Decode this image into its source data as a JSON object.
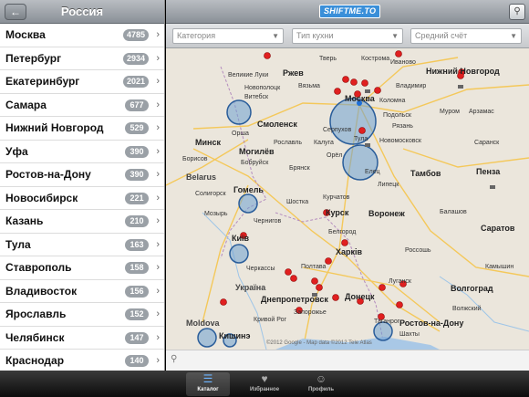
{
  "sidebar": {
    "title": "Россия",
    "back_icon": "back-arrow-icon",
    "cities": [
      {
        "name": "Москва",
        "count": "4785"
      },
      {
        "name": "Петербург",
        "count": "2934"
      },
      {
        "name": "Екатеринбург",
        "count": "2021"
      },
      {
        "name": "Самара",
        "count": "677"
      },
      {
        "name": "Нижний Новгород",
        "count": "529"
      },
      {
        "name": "Уфа",
        "count": "390"
      },
      {
        "name": "Ростов-на-Дону",
        "count": "390"
      },
      {
        "name": "Новосибирск",
        "count": "221"
      },
      {
        "name": "Казань",
        "count": "210"
      },
      {
        "name": "Тула",
        "count": "163"
      },
      {
        "name": "Ставрополь",
        "count": "158"
      },
      {
        "name": "Владивосток",
        "count": "156"
      },
      {
        "name": "Ярославль",
        "count": "152"
      },
      {
        "name": "Челябинск",
        "count": "147"
      },
      {
        "name": "Краснодар",
        "count": "140"
      }
    ]
  },
  "topbar": {
    "logo": "SHIFTME.TO",
    "pin_icon": "map-pin-icon"
  },
  "filters": {
    "category_placeholder": "Категория",
    "cuisine_placeholder": "Тип кухни",
    "check_placeholder": "Средний счёт"
  },
  "map": {
    "labels": {
      "velikie_luki": "Великие Луки",
      "vitebsk": "Витебск",
      "novopolotsk": "Новополоцк",
      "smolensk": "Смоленск",
      "vyazma": "Вязьма",
      "orsha": "Орша",
      "minsk": "Минск",
      "mogilev": "Могилёв",
      "belarus": "Belarus",
      "borisov": "Борисов",
      "bobruysk": "Бобруйск",
      "bryansk": "Брянск",
      "roslavl": "Рославль",
      "gomel": "Гомель",
      "soligorsk": "Солигорск",
      "mozyr": "Мозырь",
      "chernigov": "Чернигов",
      "shostka": "Шостка",
      "kursk": "Курск",
      "kiev": "Київ",
      "cherkassy": "Черкассы",
      "poltava": "Полтава",
      "kharkov": "Харків",
      "ukraine": "Україна",
      "dnepropetrovsk": "Днепропетровск",
      "zaporozhye": "Запорожье",
      "krivoy_rog": "Кривой Рог",
      "moldova": "Moldova",
      "kishinev": "Кишинэ",
      "moscow": "Москва",
      "serpukhov": "Серпухов",
      "kaluga": "Калуга",
      "tula": "Тула",
      "oryol": "Орёл",
      "elets": "Елец",
      "lipetsk": "Липецк",
      "tambov": "Тамбов",
      "voronezh": "Воронеж",
      "ryazan": "Рязань",
      "kolomna": "Коломна",
      "vladimir": "Владимир",
      "ivanovo": "Иваново",
      "kostroma": "Кострома",
      "nizhny": "Нижний Новгород",
      "murom": "Муром",
      "arzamas": "Арзамас",
      "saransk": "Саранск",
      "penza": "Пенза",
      "saratov": "Саратов",
      "balashov": "Балашов",
      "kamyshin": "Камышин",
      "belgorod": "Белгород",
      "volgograd": "Волгоград",
      "donetsk": "Донецк",
      "taganrog": "Таганрог",
      "rostov": "Ростов-на-Дону",
      "shakhty": "Шахты",
      "volzhsky": "Волжский",
      "rzhev": "Ржев",
      "tver": "Тверь",
      "podolsk": "Подольск",
      "novomoskovsk": "Новомосковск",
      "rossosh": "Россошь",
      "lugansk": "Луганск",
      "kursk2": "Курчатов"
    },
    "copyright": "©2012 Google - Map data ©2012 Tele Atlas"
  },
  "locbar": {
    "icon": "location-pin-icon"
  },
  "tabs": [
    {
      "label": "Каталог",
      "icon": "list-icon",
      "active": true
    },
    {
      "label": "Избранное",
      "icon": "heart-icon",
      "active": false
    },
    {
      "label": "Профиль",
      "icon": "person-icon",
      "active": false
    }
  ]
}
